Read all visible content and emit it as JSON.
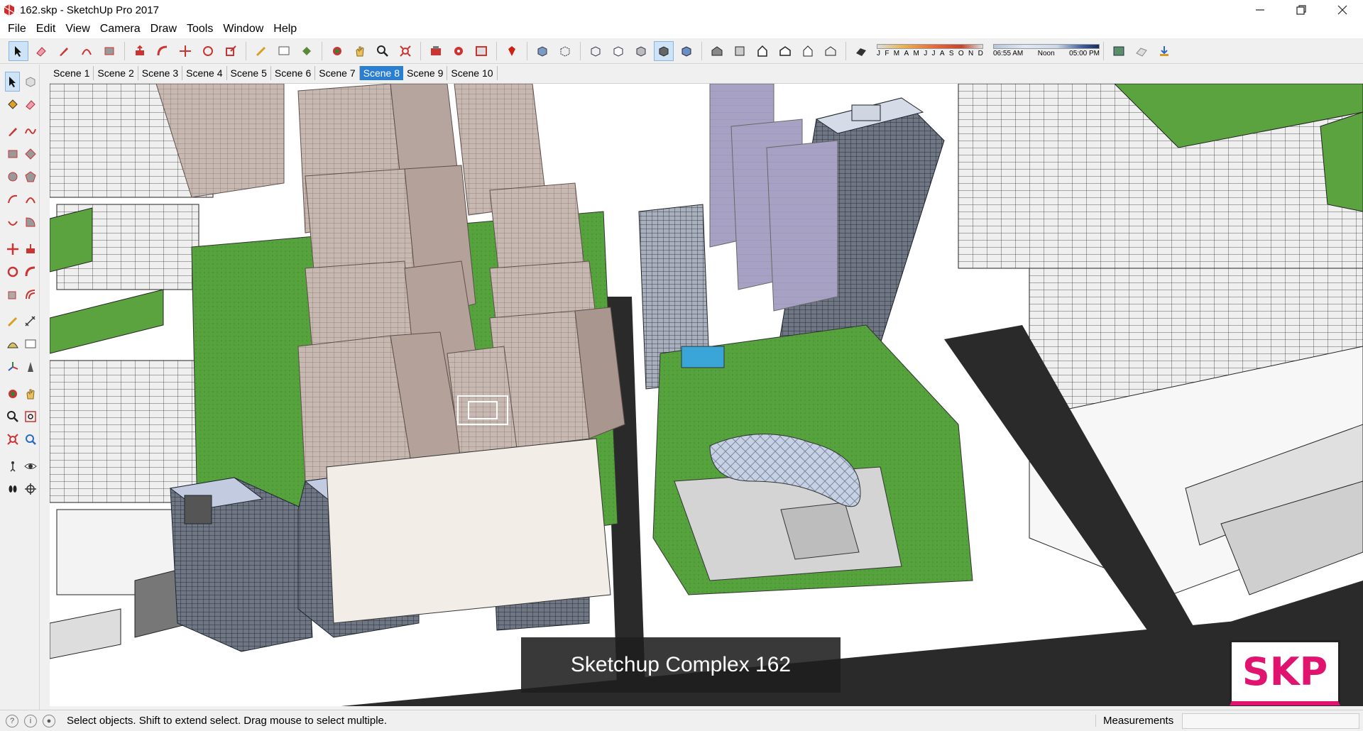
{
  "window": {
    "title": "162.skp - SketchUp Pro 2017",
    "controls": [
      "minimize",
      "maximize",
      "close"
    ]
  },
  "menu": [
    "File",
    "Edit",
    "View",
    "Camera",
    "Draw",
    "Tools",
    "Window",
    "Help"
  ],
  "toolbar": {
    "groups": [
      [
        "select-tool",
        "eraser-tool",
        "line-tool",
        "arc-tool",
        "rectangle-tool"
      ],
      [
        "push-pull-tool",
        "follow-me-tool",
        "move-tool",
        "rotate-tool",
        "scale-tool"
      ],
      [
        "tape-measure-tool",
        "text-tool",
        "paint-bucket-tool"
      ],
      [
        "orbit-tool",
        "pan-tool",
        "zoom-tool",
        "zoom-extents-tool"
      ],
      [
        "3d-warehouse",
        "extension-warehouse",
        "layout-send"
      ],
      [
        "ruby-console"
      ],
      [
        "xray-style",
        "back-edges-style"
      ],
      [
        "wireframe-style",
        "hidden-line-style",
        "shaded-style",
        "shaded-textures-style",
        "monochrome-style"
      ],
      [
        "iso-view",
        "top-view",
        "front-view",
        "right-view",
        "back-view",
        "left-view"
      ],
      [
        "shadows-toggle"
      ]
    ],
    "shadow_months": [
      "J",
      "F",
      "M",
      "A",
      "M",
      "J",
      "J",
      "A",
      "S",
      "O",
      "N",
      "D"
    ],
    "time_labels": [
      "06:55 AM",
      "Noon",
      "05:00 PM"
    ],
    "extras": [
      "geo-location",
      "sandbox",
      "add-location"
    ]
  },
  "left_toolbar": [
    [
      "select-tool",
      "make-component-tool"
    ],
    [
      "paint-bucket-tool",
      "eraser-tool"
    ],
    [
      "line-tool",
      "freehand-tool"
    ],
    [
      "rectangle-tool",
      "rotated-rectangle-tool"
    ],
    [
      "circle-tool",
      "polygon-tool"
    ],
    [
      "arc-tool",
      "two-point-arc-tool"
    ],
    [
      "three-point-arc-tool",
      "pie-tool"
    ],
    [
      "move-tool",
      "push-pull-tool"
    ],
    [
      "rotate-tool",
      "follow-me-tool"
    ],
    [
      "scale-tool",
      "offset-tool"
    ],
    [
      "tape-measure-tool",
      "dimension-tool"
    ],
    [
      "protractor-tool",
      "text-tool"
    ],
    [
      "axes-tool",
      "3d-text-tool"
    ],
    [
      "orbit-tool",
      "pan-tool"
    ],
    [
      "zoom-tool",
      "zoom-window-tool"
    ],
    [
      "zoom-extents-tool",
      "previous-view-tool"
    ],
    [
      "position-camera-tool",
      "look-around-tool"
    ],
    [
      "walk-tool",
      "section-plane-tool"
    ]
  ],
  "scenes": [
    "Scene 1",
    "Scene 2",
    "Scene 3",
    "Scene 4",
    "Scene 5",
    "Scene 6",
    "Scene 7",
    "Scene 8",
    "Scene 9",
    "Scene 10"
  ],
  "active_scene": "Scene 8",
  "viewport": {
    "caption": "Sketchup Complex 162",
    "logo": "SKP"
  },
  "status": {
    "hint": "Select objects. Shift to extend select. Drag mouse to select multiple.",
    "measurements_label": "Measurements",
    "measurements_value": ""
  },
  "colors": {
    "accent": "#2b7fd3",
    "grass": "#5aa33e",
    "building": "#c4b6b0",
    "glass": "#8894a6",
    "road": "#2a2a2a",
    "logo": "#e0136f"
  }
}
